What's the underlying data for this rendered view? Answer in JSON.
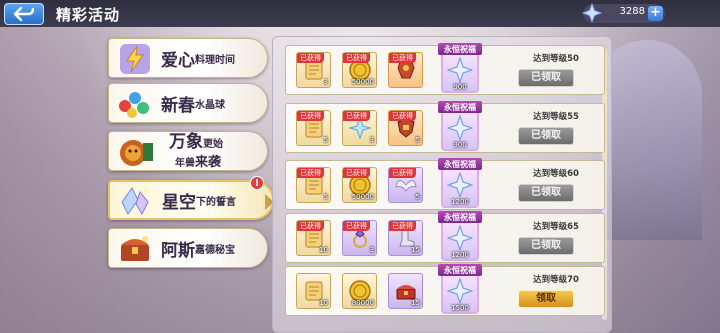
{
  "header": {
    "title": "精彩活动",
    "currency_value": "3288",
    "currency_icon": "star-crystal-icon",
    "plus_label": "+"
  },
  "tabs": [
    {
      "name": "爱心料理时间",
      "main": "爱心",
      "sub": "料理时间",
      "icon": "lightning-icon",
      "active": false
    },
    {
      "name": "新春水晶球",
      "main": "新春",
      "sub": "水晶球",
      "icon": "crystal-gems-icon",
      "active": false
    },
    {
      "name": "万象更始年兽来袭",
      "line1_big": "万象",
      "line1_small": "更始",
      "line2_small": "年兽",
      "line2_big": "来袭",
      "icon": "lion-beast-icon",
      "active": false
    },
    {
      "name": "星空下的誓言",
      "main": "星空",
      "sub": "下的誓言",
      "icon": "star-crystal-icon",
      "active": true,
      "badge": "!"
    },
    {
      "name": "阿斯嘉德秘宝",
      "main": "阿斯",
      "sub": "嘉德秘宝",
      "icon": "treasure-chest-icon",
      "active": false
    }
  ],
  "rewards": {
    "obtained_label": "已获得",
    "bless_label": "永恒祝福",
    "rows": [
      {
        "level": "达到等级50",
        "items": [
          {
            "icon": "scroll-icon",
            "count": "3",
            "obtained": true,
            "style": "gold"
          },
          {
            "icon": "gold-coin-icon",
            "count": "50000",
            "obtained": true,
            "style": "gold"
          },
          {
            "icon": "armor-icon",
            "count": "",
            "obtained": true,
            "style": "orange"
          }
        ],
        "bless_count": "900",
        "button": "已领取",
        "claimed": true
      },
      {
        "level": "达到等级55",
        "items": [
          {
            "icon": "scroll-icon",
            "count": "5",
            "obtained": true,
            "style": "gold"
          },
          {
            "icon": "ice-crystal-icon",
            "count": "3",
            "obtained": true,
            "style": "gold"
          },
          {
            "icon": "shield-gear-icon",
            "count": "5",
            "obtained": true,
            "style": "orange"
          }
        ],
        "bless_count": "900",
        "button": "已领取",
        "claimed": true
      },
      {
        "level": "达到等级60",
        "items": [
          {
            "icon": "scroll-icon",
            "count": "5",
            "obtained": true,
            "style": "gold"
          },
          {
            "icon": "gold-coin-icon",
            "count": "50000",
            "obtained": true,
            "style": "gold"
          },
          {
            "icon": "wings-icon",
            "count": "5",
            "obtained": true,
            "style": "purple"
          }
        ],
        "bless_count": "1200",
        "button": "已领取",
        "claimed": true
      },
      {
        "level": "达到等级65",
        "items": [
          {
            "icon": "scroll-icon",
            "count": "10",
            "obtained": true,
            "style": "gold"
          },
          {
            "icon": "gem-ring-icon",
            "count": "3",
            "obtained": true,
            "style": "purple"
          },
          {
            "icon": "boots-icon",
            "count": "15",
            "obtained": true,
            "style": "purple"
          }
        ],
        "bless_count": "1200",
        "button": "已领取",
        "claimed": true
      },
      {
        "level": "达到等级70",
        "items": [
          {
            "icon": "scroll-icon",
            "count": "10",
            "obtained": false,
            "style": "gold"
          },
          {
            "icon": "gold-coin-icon",
            "count": "80000",
            "obtained": false,
            "style": "gold"
          },
          {
            "icon": "red-chest-icon",
            "count": "15",
            "obtained": false,
            "style": "purple"
          }
        ],
        "bless_count": "1500",
        "button": "领取",
        "claimed": false
      }
    ]
  },
  "colors": {
    "header_bg": "#2f2f3f",
    "claimed_button": "#8a8a8a",
    "claim_button": "#e8a72e",
    "obtained_ribbon": "#e3343a",
    "bless_banner": "#b64ab0"
  }
}
